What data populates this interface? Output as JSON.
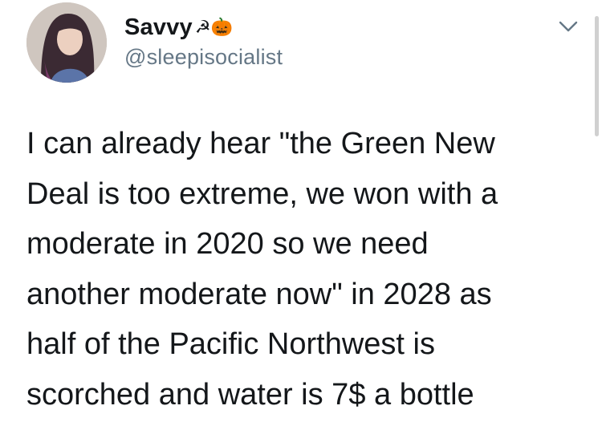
{
  "author": {
    "display_name": "Savvy",
    "name_emojis": "☭🎃",
    "handle": "@sleepisocialist"
  },
  "icons": {
    "avatar": "profile-photo",
    "caret": "chevron-down-icon"
  },
  "tweet": {
    "text": "I can already hear \"the Green New\nDeal is too extreme, we won with a\nmoderate in 2020 so we need\nanother moderate now\" in 2028 as\nhalf of the Pacific Northwest is\nscorched and water is 7$ a bottle"
  },
  "colors": {
    "text": "#14171a",
    "secondary": "#657786",
    "background": "#ffffff"
  }
}
